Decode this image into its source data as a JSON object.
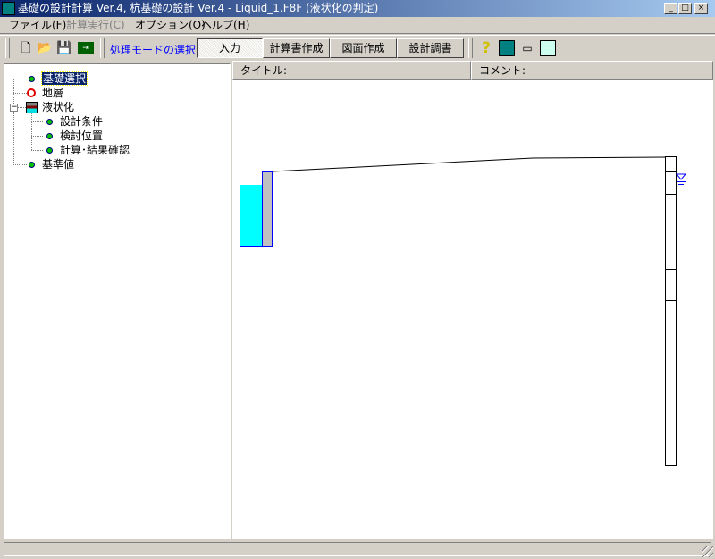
{
  "window": {
    "title": "基礎の設計計算 Ver.4, 杭基礎の設計 Ver.4 - Liquid_1.F8F (液状化の判定)",
    "minimize": "_",
    "maximize": "□",
    "close": "×"
  },
  "menu": [
    {
      "label": "ファイル(F)"
    },
    {
      "label": "計算実行(C)"
    },
    {
      "label": "オプション(O)"
    },
    {
      "label": "ヘルプ(H)"
    }
  ],
  "toolbar": {
    "mode_label": "処理モードの選択",
    "modes": [
      "入力",
      "計算書作成",
      "図面作成",
      "設計調書"
    ],
    "active_mode": "入力"
  },
  "tree": {
    "items": [
      {
        "label": "基礎選択",
        "selected": true
      },
      {
        "label": "地層"
      },
      {
        "label": "液状化",
        "expanded": true
      },
      {
        "label": "設計条件"
      },
      {
        "label": "検討位置"
      },
      {
        "label": "計算･結果確認"
      },
      {
        "label": "基準値"
      }
    ],
    "collapse": "−"
  },
  "header": {
    "title_label": "タイトル:",
    "comment_label": "コメント:"
  },
  "colors": {
    "accent": "#0000ff",
    "cyan": "#00ffff",
    "titlebar": "#0a246a"
  }
}
